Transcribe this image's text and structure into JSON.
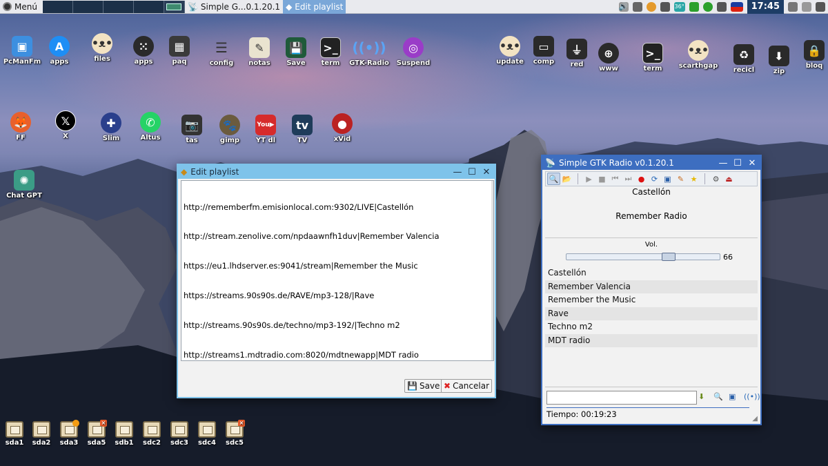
{
  "taskbar": {
    "menu_label": "Menú",
    "tasks": [
      {
        "label": "Simple G...0.1.20.1"
      },
      {
        "label": "Edit playlist"
      }
    ],
    "tray": {
      "battery_badge": "36°",
      "clock": "17:45"
    }
  },
  "desktop_icons_row1": [
    {
      "label": "PcManFm",
      "icon": "folder-manager-icon",
      "color": "#3d8fe0"
    },
    {
      "label": "apps",
      "icon": "app-store-icon",
      "color": "#1e8ef5"
    },
    {
      "label": "files",
      "icon": "puppy-files-icon",
      "color": "#f3e3c3"
    },
    {
      "label": "apps",
      "icon": "apps-grid-icon",
      "color": "#2a2a2a"
    },
    {
      "label": "paq",
      "icon": "package-icon",
      "color": "#3a3a3a"
    },
    {
      "label": "config",
      "icon": "sliders-icon",
      "color": "#4a4a4a"
    },
    {
      "label": "notas",
      "icon": "notes-icon",
      "color": "#4a4a4a"
    },
    {
      "label": "Save",
      "icon": "floppy-icon",
      "color": "#1f5a3a"
    },
    {
      "label": "term",
      "icon": "terminal-icon",
      "color": "#222"
    },
    {
      "label": "GTK-Radio",
      "icon": "radio-antenna-icon",
      "color": "#3d6ec0"
    },
    {
      "label": "Suspend",
      "icon": "suspend-icon",
      "color": "#9a3cc8"
    }
  ],
  "desktop_icons_right": [
    {
      "label": "update",
      "icon": "update-icon",
      "color": "#f3e3c3"
    },
    {
      "label": "comp",
      "icon": "computer-icon",
      "color": "#2a2a2a"
    },
    {
      "label": "red",
      "icon": "network-plug-icon",
      "color": "#2a2a2a"
    },
    {
      "label": "www",
      "icon": "globe-icon",
      "color": "#2a2a2a"
    },
    {
      "label": "term",
      "icon": "terminal-icon",
      "color": "#222"
    },
    {
      "label": "scarthgap",
      "icon": "puppy-icon",
      "color": "#f3e3c3"
    },
    {
      "label": "recicl",
      "icon": "recycle-icon",
      "color": "#2a2a2a"
    },
    {
      "label": "zip",
      "icon": "archive-icon",
      "color": "#2a2a2a"
    },
    {
      "label": "bloq",
      "icon": "lock-icon",
      "color": "#2a2a2a"
    }
  ],
  "desktop_icons_row2": [
    {
      "label": "FF",
      "icon": "firefox-icon",
      "color": "#e8602c"
    },
    {
      "label": "X",
      "icon": "x-logo-icon",
      "color": "#000"
    },
    {
      "label": "Slim",
      "icon": "uk-flag-icon",
      "color": "#2a3f8c"
    },
    {
      "label": "Altus",
      "icon": "whatsapp-icon",
      "color": "#25d366"
    },
    {
      "label": "tas",
      "icon": "camera-icon",
      "color": "#333"
    },
    {
      "label": "gimp",
      "icon": "gimp-icon",
      "color": "#6b5b3e"
    },
    {
      "label": "YT dl",
      "icon": "youtube-icon",
      "color": "#d62b2b"
    },
    {
      "label": "TV",
      "icon": "tv-icon",
      "color": "#1f3c5a"
    },
    {
      "label": "xVid",
      "icon": "xvid-icon",
      "color": "#b22"
    }
  ],
  "chatgpt_icon": {
    "label": "Chat GPT",
    "icon": "chatgpt-icon",
    "color": "#3b9c86"
  },
  "drives": [
    {
      "label": "sda1",
      "mark": ""
    },
    {
      "label": "sda2",
      "mark": ""
    },
    {
      "label": "sda3",
      "mark": "dot"
    },
    {
      "label": "sda5",
      "mark": "x"
    },
    {
      "label": "sdb1",
      "mark": ""
    },
    {
      "label": "sdc2",
      "mark": ""
    },
    {
      "label": "sdc3",
      "mark": ""
    },
    {
      "label": "sdc4",
      "mark": ""
    },
    {
      "label": "sdc5",
      "mark": "x"
    }
  ],
  "edit_playlist": {
    "title": "Edit playlist",
    "lines": [
      "http://rememberfm.emisionlocal.com:9302/LIVE|Castellón",
      "http://stream.zenolive.com/npdaawnfh1duv|Remember Valencia",
      "https://eu1.lhdserver.es:9041/stream|Remember the Music",
      "https://streams.90s90s.de/RAVE/mp3-128/|Rave",
      "http://streams.90s90s.de/techno/mp3-192/|Techno m2",
      "http://streams1.mdtradio.com:8020/mdtnewapp|MDT radio"
    ],
    "save_label": "Save",
    "cancel_label": "Cancelar"
  },
  "gtk_radio": {
    "title": "Simple GTK Radio v0.1.20.1",
    "station": "Castellón",
    "song": "Remember Radio",
    "vol_label": "Vol.",
    "volume": 66,
    "volume_fraction": 0.66,
    "stations": [
      "Castellón",
      "Remember Valencia",
      "Remember the Music",
      "Rave",
      "Techno m2",
      "MDT radio"
    ],
    "search_value": "",
    "time_text": "Tiempo: 00:19:23"
  }
}
